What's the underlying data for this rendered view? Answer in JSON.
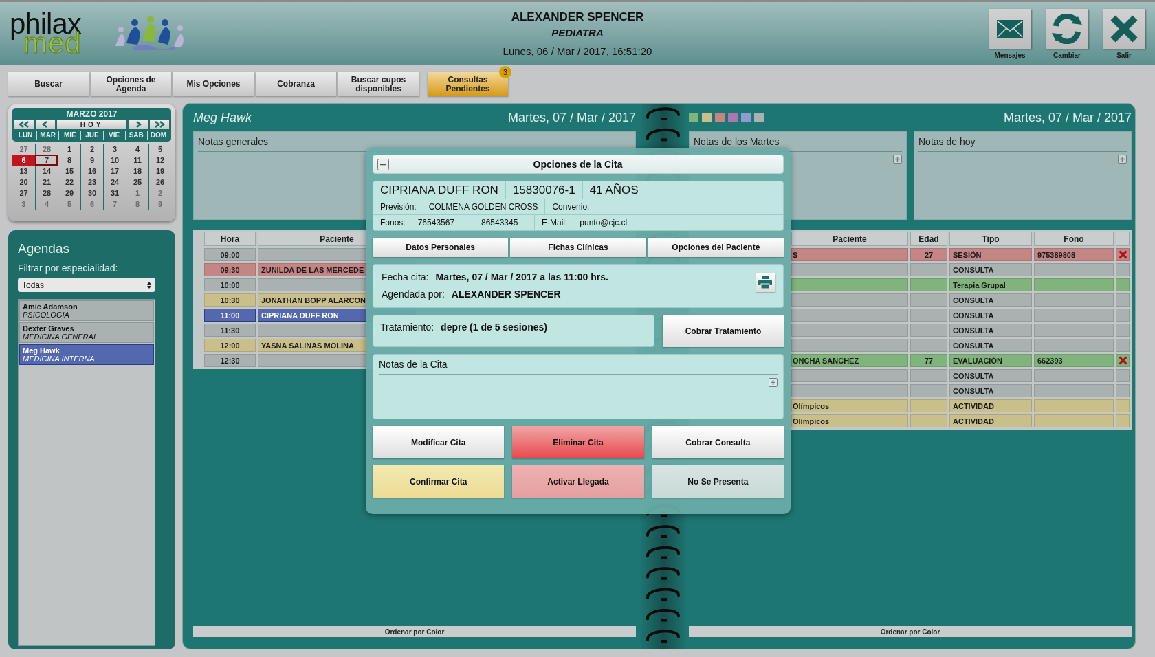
{
  "header": {
    "logo_text": "philax",
    "logo_subtext": "med",
    "user": "ALEXANDER SPENCER",
    "role": "PEDIATRA",
    "datetime": "Lunes, 06 / Mar / 2017, 16:51:20",
    "actions": [
      {
        "kind": "mail",
        "label": "Mensajes"
      },
      {
        "kind": "refresh",
        "label": "Cambiar"
      },
      {
        "kind": "close",
        "label": "Salir"
      }
    ]
  },
  "nav": [
    {
      "label": "Buscar",
      "highlighted": false
    },
    {
      "label": "Opciones de Agenda",
      "highlighted": false
    },
    {
      "label": "Mis Opciones",
      "highlighted": false
    },
    {
      "label": "Cobranza",
      "highlighted": false
    },
    {
      "label": "Buscar cupos disponibles",
      "highlighted": false
    },
    {
      "label": "Consultas Pendientes",
      "highlighted": true,
      "badge": "3"
    }
  ],
  "calendar": {
    "title": "MARZO 2017",
    "today_button": "HOY",
    "weekdays": [
      "LUN",
      "MAR",
      "MIÉ",
      "JUE",
      "VIE",
      "SAB",
      "DOM"
    ],
    "weeks": [
      [
        {
          "day": "27",
          "muted": true,
          "today": false,
          "selected": false
        },
        {
          "day": "28",
          "muted": true,
          "today": false,
          "selected": false
        },
        {
          "day": "1",
          "muted": false,
          "today": false,
          "selected": false
        },
        {
          "day": "2",
          "muted": false,
          "today": false,
          "selected": false
        },
        {
          "day": "3",
          "muted": false,
          "today": false,
          "selected": false
        },
        {
          "day": "4",
          "muted": false,
          "today": false,
          "selected": false
        },
        {
          "day": "5",
          "muted": false,
          "today": false,
          "selected": false
        }
      ],
      [
        {
          "day": "6",
          "muted": false,
          "today": true,
          "selected": false
        },
        {
          "day": "7",
          "muted": false,
          "today": false,
          "selected": true
        },
        {
          "day": "8",
          "muted": false,
          "today": false,
          "selected": false
        },
        {
          "day": "9",
          "muted": false,
          "today": false,
          "selected": false
        },
        {
          "day": "10",
          "muted": false,
          "today": false,
          "selected": false
        },
        {
          "day": "11",
          "muted": false,
          "today": false,
          "selected": false
        },
        {
          "day": "12",
          "muted": false,
          "today": false,
          "selected": false
        }
      ],
      [
        {
          "day": "13",
          "muted": false,
          "today": false,
          "selected": false
        },
        {
          "day": "14",
          "muted": false,
          "today": false,
          "selected": false
        },
        {
          "day": "15",
          "muted": false,
          "today": false,
          "selected": false
        },
        {
          "day": "16",
          "muted": false,
          "today": false,
          "selected": false
        },
        {
          "day": "17",
          "muted": false,
          "today": false,
          "selected": false
        },
        {
          "day": "18",
          "muted": false,
          "today": false,
          "selected": false
        },
        {
          "day": "19",
          "muted": false,
          "today": false,
          "selected": false
        }
      ],
      [
        {
          "day": "20",
          "muted": false,
          "today": false,
          "selected": false
        },
        {
          "day": "21",
          "muted": false,
          "today": false,
          "selected": false
        },
        {
          "day": "22",
          "muted": false,
          "today": false,
          "selected": false
        },
        {
          "day": "23",
          "muted": false,
          "today": false,
          "selected": false
        },
        {
          "day": "24",
          "muted": false,
          "today": false,
          "selected": false
        },
        {
          "day": "25",
          "muted": false,
          "today": false,
          "selected": false
        },
        {
          "day": "26",
          "muted": false,
          "today": false,
          "selected": false
        }
      ],
      [
        {
          "day": "27",
          "muted": false,
          "today": false,
          "selected": false
        },
        {
          "day": "28",
          "muted": false,
          "today": false,
          "selected": false
        },
        {
          "day": "29",
          "muted": false,
          "today": false,
          "selected": false
        },
        {
          "day": "30",
          "muted": false,
          "today": false,
          "selected": false
        },
        {
          "day": "31",
          "muted": false,
          "today": false,
          "selected": false
        },
        {
          "day": "1",
          "muted": true,
          "today": false,
          "selected": false
        },
        {
          "day": "2",
          "muted": true,
          "today": false,
          "selected": false
        }
      ],
      [
        {
          "day": "3",
          "muted": true,
          "today": false,
          "selected": false
        },
        {
          "day": "4",
          "muted": true,
          "today": false,
          "selected": false
        },
        {
          "day": "5",
          "muted": true,
          "today": false,
          "selected": false
        },
        {
          "day": "6",
          "muted": true,
          "today": false,
          "selected": false
        },
        {
          "day": "7",
          "muted": true,
          "today": false,
          "selected": false
        },
        {
          "day": "8",
          "muted": true,
          "today": false,
          "selected": false
        },
        {
          "day": "9",
          "muted": true,
          "today": false,
          "selected": false
        }
      ]
    ]
  },
  "agendas": {
    "title": "Agendas",
    "filter_label": "Filtrar por especialidad:",
    "filter_value": "Todas",
    "items": [
      {
        "name": "Amie Adamson",
        "specialty": "PSICOLOGIA",
        "selected": false
      },
      {
        "name": "Dexter Graves",
        "specialty": "MEDICINA GENERAL",
        "selected": false
      },
      {
        "name": "Meg Hawk",
        "specialty": "MEDICINA INTERNA",
        "selected": true
      }
    ]
  },
  "left_page": {
    "doctor": "Meg Hawk",
    "date": "Martes, 07 / Mar / 2017",
    "notes_title": "Notas generales",
    "columns": [
      "Hora",
      "Paciente"
    ],
    "rows": [
      {
        "time": "09:00",
        "patient": "",
        "color": "#a9b1b1",
        "selected": false
      },
      {
        "time": "09:30",
        "patient": "ZUNILDA DE LAS MERCEDE",
        "color": "#c48585",
        "selected": false
      },
      {
        "time": "10:00",
        "patient": "",
        "color": "#a9b1b1",
        "selected": false
      },
      {
        "time": "10:30",
        "patient": "JONATHAN BOPP ALARCON",
        "color": "#c9bf8a",
        "selected": false
      },
      {
        "time": "11:00",
        "patient": "CIPRIANA DUFF RON",
        "color": "#5468b0",
        "selected": true
      },
      {
        "time": "11:30",
        "patient": "",
        "color": "#a9b1b1",
        "selected": false
      },
      {
        "time": "12:00",
        "patient": "YASNA SALINAS MOLINA",
        "color": "#c9bf8a",
        "selected": false
      },
      {
        "time": "12:30",
        "patient": "",
        "color": "#a9b1b1",
        "selected": false
      }
    ],
    "sort_button": "Ordenar por Color"
  },
  "right_page": {
    "legend": [
      {
        "color": "#80b47c"
      },
      {
        "color": "#c9bf8a"
      },
      {
        "color": "#c48585"
      },
      {
        "color": "#a878b0"
      },
      {
        "color": "#8c9ccc"
      },
      {
        "color": "#a9b1b1"
      }
    ],
    "date": "Martes, 07 / Mar / 2017",
    "notes": [
      {
        "title": "Notas de los Martes"
      },
      {
        "title": "Notas de hoy"
      }
    ],
    "columns": [
      "Paciente",
      "Edad",
      "Tipo",
      "Fono"
    ],
    "rows": [
      {
        "patient": "S",
        "age": "27",
        "type": "SESIÓN",
        "phone": "975389808",
        "color": "#c48585",
        "deletable": true
      },
      {
        "patient": "",
        "age": "",
        "type": "CONSULTA",
        "phone": "",
        "color": "#a9b1b1",
        "deletable": false
      },
      {
        "patient": "",
        "age": "",
        "type": "Terapia Grupal",
        "phone": "",
        "color": "#80b47c",
        "deletable": false
      },
      {
        "patient": "",
        "age": "",
        "type": "CONSULTA",
        "phone": "",
        "color": "#a9b1b1",
        "deletable": false
      },
      {
        "patient": "",
        "age": "",
        "type": "CONSULTA",
        "phone": "",
        "color": "#a9b1b1",
        "deletable": false
      },
      {
        "patient": "",
        "age": "",
        "type": "CONSULTA",
        "phone": "",
        "color": "#a9b1b1",
        "deletable": false
      },
      {
        "patient": "",
        "age": "",
        "type": "CONSULTA",
        "phone": "",
        "color": "#a9b1b1",
        "deletable": false
      },
      {
        "patient": "ONCHA SANCHEZ",
        "age": "77",
        "type": "EVALUACIÓN",
        "phone": "662393",
        "color": "#80b47c",
        "deletable": true
      },
      {
        "patient": "",
        "age": "",
        "type": "CONSULTA",
        "phone": "",
        "color": "#a9b1b1",
        "deletable": false
      },
      {
        "patient": "",
        "age": "",
        "type": "CONSULTA",
        "phone": "",
        "color": "#a9b1b1",
        "deletable": false
      },
      {
        "patient": "Olímpicos",
        "age": "",
        "type": "ACTIVIDAD",
        "phone": "",
        "color": "#c9bf8a",
        "deletable": false
      },
      {
        "patient": "Olímpicos",
        "age": "",
        "type": "ACTIVIDAD",
        "phone": "",
        "color": "#c9bf8a",
        "deletable": false
      }
    ],
    "sort_button": "Ordenar por Color"
  },
  "modal": {
    "title": "Opciones de la Cita",
    "patient": {
      "name": "CIPRIANA DUFF RON",
      "id": "15830076-1",
      "age": "41 AÑOS",
      "insurance_label": "Previsión:",
      "insurance": "COLMENA GOLDEN CROSS",
      "agreement_label": "Convenio:",
      "phones_label": "Fonos:",
      "phones": [
        "76543567",
        "86543345"
      ],
      "email_label": "E-Mail:",
      "email": "punto@cjc.cl"
    },
    "patient_buttons": [
      "Datos Personales",
      "Fichas Clínicas",
      "Opciones del Paciente"
    ],
    "appointment": {
      "date_label": "Fecha cita:",
      "date": "Martes, 07 / Mar / 2017 a las 11:00 hrs.",
      "booked_by_label": "Agendada por:",
      "booked_by": "ALEXANDER SPENCER"
    },
    "treatment": {
      "label": "Tratamiento:",
      "value": "depre (1 de 5 sesiones)",
      "button": "Cobrar Tratamiento"
    },
    "notes_title": "Notas de la Cita",
    "actions": [
      {
        "label": "Modificar Cita",
        "kind": "plain"
      },
      {
        "label": "Eliminar Cita",
        "kind": "danger"
      },
      {
        "label": "Cobrar Consulta",
        "kind": "plain"
      },
      {
        "label": "Confirmar Cita",
        "kind": "confirm"
      },
      {
        "label": "Activar Llegada",
        "kind": "arrival"
      },
      {
        "label": "No Se Presenta",
        "kind": "muted"
      }
    ]
  }
}
